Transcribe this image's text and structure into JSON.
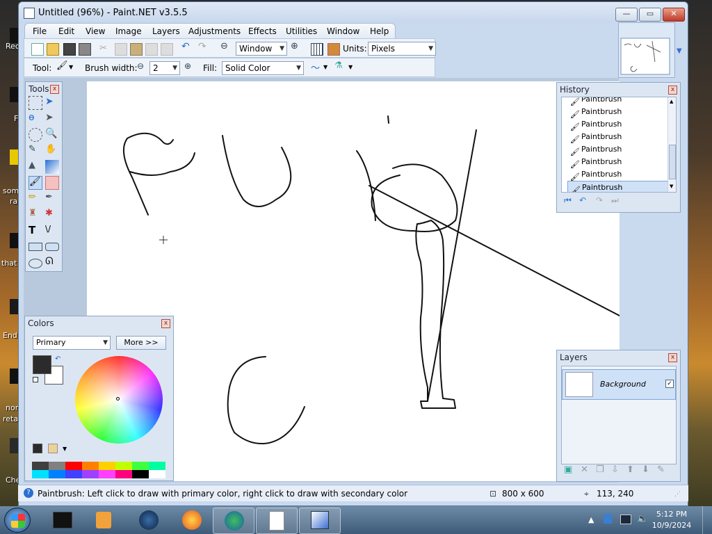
{
  "window": {
    "title": "Untitled (96%) - Paint.NET v3.5.5",
    "minimize": "—",
    "maximize": "▭",
    "close": "✕"
  },
  "menu": [
    "File",
    "Edit",
    "View",
    "Image",
    "Layers",
    "Adjustments",
    "Effects",
    "Utilities",
    "Window",
    "Help"
  ],
  "toolbar": {
    "zoom_value": "Window",
    "units_label": "Units:",
    "units_value": "Pixels",
    "tool_label": "Tool:",
    "brush_width_label": "Brush width:",
    "brush_width_value": "2",
    "fill_label": "Fill:",
    "fill_value": "Solid Color"
  },
  "tools_panel": {
    "title": "Tools"
  },
  "colors_panel": {
    "title": "Colors",
    "mode": "Primary",
    "more_button": "More >>",
    "primary_color": "#2b2b2b",
    "secondary_color": "#ffffff"
  },
  "history_panel": {
    "title": "History",
    "items": [
      "Paintbrush",
      "Paintbrush",
      "Paintbrush",
      "Paintbrush",
      "Paintbrush",
      "Paintbrush",
      "Paintbrush",
      "Paintbrush"
    ]
  },
  "layers_panel": {
    "title": "Layers",
    "layers": [
      "Background"
    ]
  },
  "status": {
    "hint": "Paintbrush: Left click to draw with primary color, right click to draw with secondary color",
    "image_size": "800 x 600",
    "cursor_pos": "113, 240"
  },
  "taskbar": {
    "time": "5:12 PM",
    "date": "10/9/2024"
  },
  "desktop_labels": [
    "Rec",
    "F",
    "som",
    "ra",
    "that",
    "End",
    "nor",
    "reta",
    "Che"
  ],
  "palette": [
    "#404040",
    "#808080",
    "#ff0000",
    "#ff8000",
    "#ffd000",
    "#c0ff00",
    "#40ff40",
    "#00ffa0",
    "#00e0ff",
    "#0080ff",
    "#4040ff",
    "#a040ff",
    "#ff40ff",
    "#ff0080",
    "#000000",
    "#ffffff"
  ]
}
